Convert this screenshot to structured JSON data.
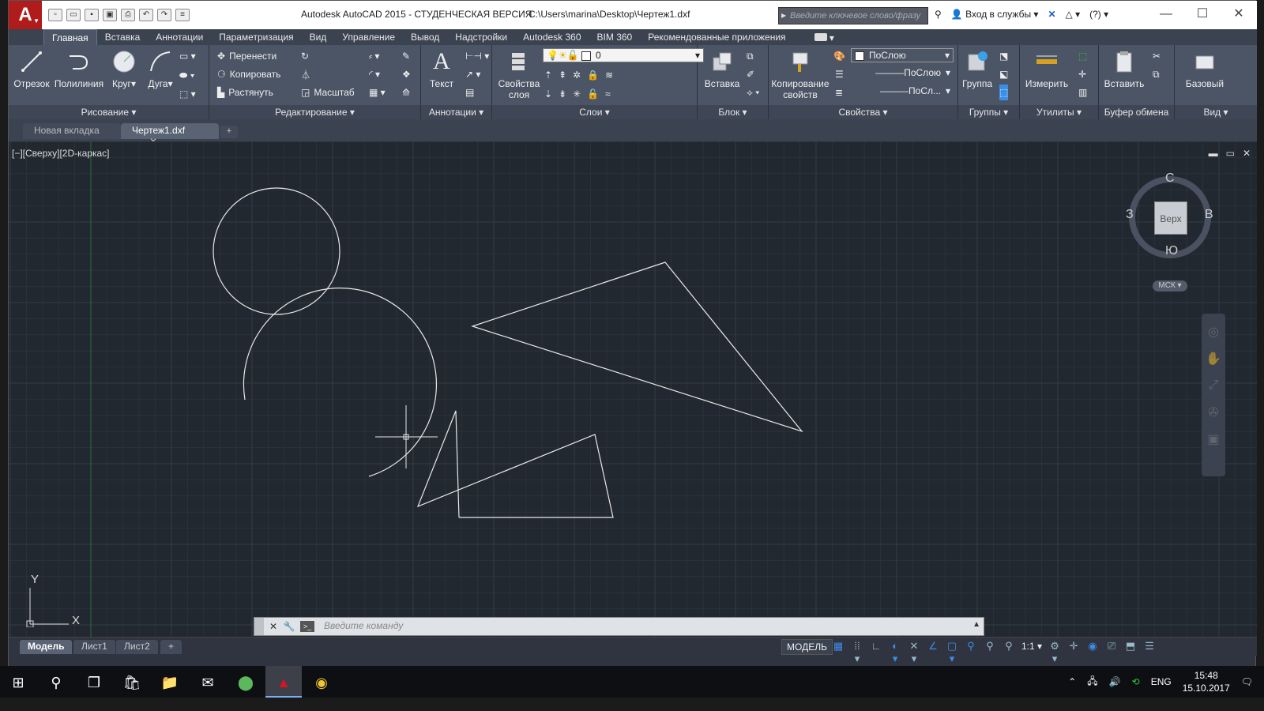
{
  "window": {
    "app_logo": "A",
    "title": "Autodesk AutoCAD 2015 - СТУДЕНЧЕСКАЯ ВЕРСИЯ",
    "file_path": "C:\\Users\\marina\\Desktop\\Чертеж1.dxf",
    "search_placeholder": "Введите ключевое слово/фразу",
    "sign_in": "Вход в службы",
    "help": "?"
  },
  "ribbon_tabs": [
    "Главная",
    "Вставка",
    "Аннотации",
    "Параметризация",
    "Вид",
    "Управление",
    "Вывод",
    "Надстройки",
    "Autodesk 360",
    "BIM 360",
    "Рекомендованные приложения"
  ],
  "ribbon": {
    "draw": {
      "title": "Рисование ▾",
      "line": "Отрезок",
      "polyline": "Полилиния",
      "circle": "Круг",
      "arc": "Дуга"
    },
    "modify": {
      "title": "Редактирование ▾",
      "move": "Перенести",
      "copy": "Копировать",
      "stretch": "Растянуть",
      "scale": "Масштаб"
    },
    "annotation": {
      "title": "Аннотации ▾",
      "text": "Текст"
    },
    "layers": {
      "title": "Слои ▾",
      "layer_props_1": "Свойства",
      "layer_props_2": "слоя",
      "current_layer": "0"
    },
    "block": {
      "title": "Блок ▾",
      "insert": "Вставка"
    },
    "properties": {
      "title": "Свойства ▾",
      "match_1": "Копирование",
      "match_2": "свойств",
      "color": "ПоСлою",
      "linetype": "ПоСлою",
      "lineweight": "ПоСл..."
    },
    "groups": {
      "title": "Группы ▾",
      "group": "Группа"
    },
    "utilities": {
      "title": "Утилиты ▾",
      "measure": "Измерить"
    },
    "clipboard": {
      "title": "Буфер обмена",
      "paste": "Вставить"
    },
    "view": {
      "title": "Вид ▾",
      "base": "Базовый"
    }
  },
  "file_tabs": {
    "new_tab": "Новая вкладка",
    "current": "Чертеж1.dxf",
    "close": "✕",
    "add": "+"
  },
  "viewport": {
    "label": "[−][Сверху][2D-каркас]",
    "min": "▬",
    "restore": "▭",
    "close": "✕"
  },
  "viewcube": {
    "face": "Верх",
    "north": "С",
    "south": "Ю",
    "west": "З",
    "east": "В",
    "wcs": "МСК ▾"
  },
  "ucs": {
    "x": "X",
    "y": "Y"
  },
  "command_line": {
    "close": "✕",
    "settings": "🔧",
    "placeholder": "Введите команду"
  },
  "layout_tabs": [
    "Модель",
    "Лист1",
    "Лист2",
    "+"
  ],
  "status": {
    "model": "МОДЕЛЬ",
    "scale": "1:1 ▾"
  },
  "taskbar": {
    "lang": "ENG",
    "time": "15:48",
    "date": "15.10.2017"
  },
  "colors": {
    "canvas_bg": "#212830",
    "ribbon_bg": "#4c5566",
    "geometry": "#ffffff",
    "accent": "#3a8ee6"
  }
}
